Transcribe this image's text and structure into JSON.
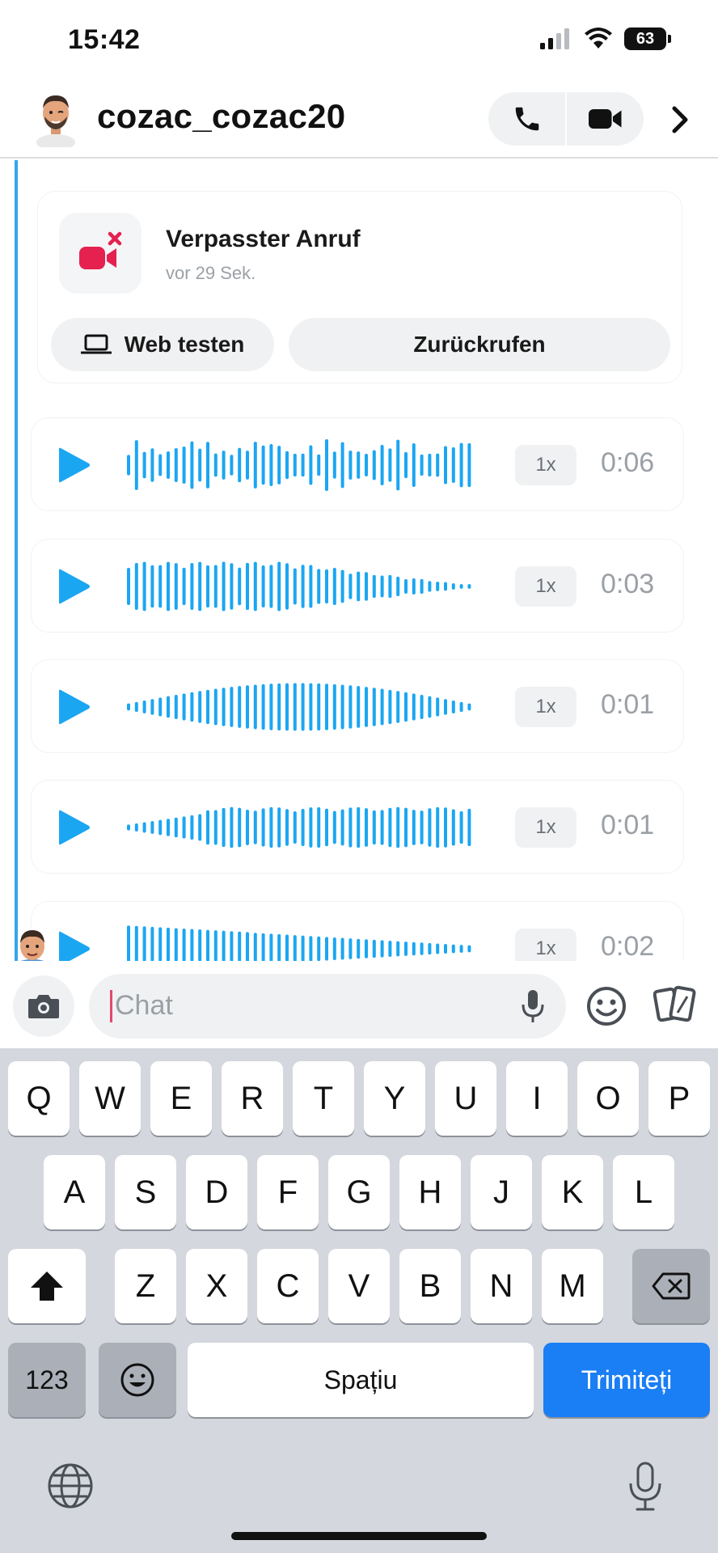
{
  "status_bar": {
    "time": "15:42",
    "battery": "63"
  },
  "header": {
    "username": "cozac_cozac20"
  },
  "missed_call": {
    "title": "Verpasster Anruf",
    "time": "vor 29 Sek.",
    "web_button": "Web testen",
    "callback_button": "Zurückrufen"
  },
  "voice_notes": [
    {
      "speed": "1x",
      "duration": "0:06"
    },
    {
      "speed": "1x",
      "duration": "0:03"
    },
    {
      "speed": "1x",
      "duration": "0:01"
    },
    {
      "speed": "1x",
      "duration": "0:01"
    },
    {
      "speed": "1x",
      "duration": "0:02"
    }
  ],
  "input": {
    "placeholder": "Chat"
  },
  "keyboard": {
    "row1": [
      "Q",
      "W",
      "E",
      "R",
      "T",
      "Y",
      "U",
      "I",
      "O",
      "P"
    ],
    "row2": [
      "A",
      "S",
      "D",
      "F",
      "G",
      "H",
      "J",
      "K",
      "L"
    ],
    "row3": [
      "Z",
      "X",
      "C",
      "V",
      "B",
      "N",
      "M"
    ],
    "numbers_label": "123",
    "space_label": "Spațiu",
    "send_label": "Trimiteți"
  },
  "colors": {
    "accent_blue": "#1ba6f2",
    "send_key": "#1a7ef5",
    "missed_red": "#e5214f"
  }
}
